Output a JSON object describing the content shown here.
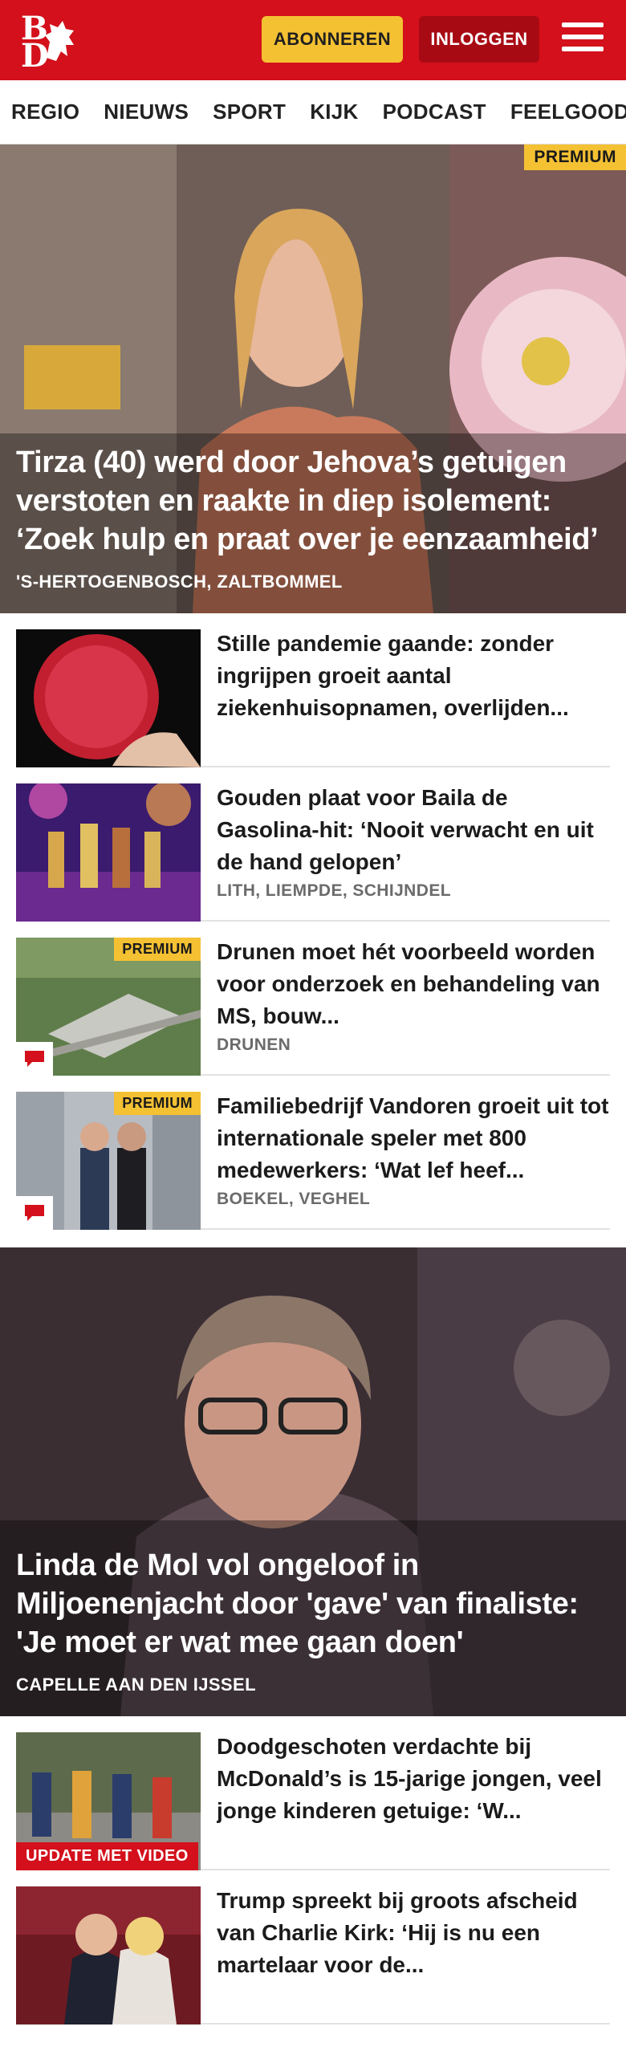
{
  "header": {
    "logo_text_top": "B",
    "logo_text_bottom": "D",
    "subscribe_label": "ABONNEREN",
    "login_label": "INLOGGEN",
    "brand_color": "#d3101b"
  },
  "nav": {
    "items": [
      "REGIO",
      "NIEUWS",
      "SPORT",
      "KIJK",
      "PODCAST",
      "FEELGOOD"
    ]
  },
  "hero1": {
    "badge": "PREMIUM",
    "title": "Tirza (40) werd door Jehova’s getuigen verstoten en raakte in diep isolement: ‘Zoek hulp en praat over je eenzaamheid’",
    "location": "'S-HERTOGENBOSCH, ZALTBOMMEL"
  },
  "articles1": [
    {
      "title": "Stille pandemie gaande: zonder ingrijpen groeit aantal ziekenhuisopnamen, overlijden...",
      "location": ""
    },
    {
      "title": "Gouden plaat voor Baila de Gasolina-hit: ‘Nooit verwacht en uit de hand gelopen’",
      "location": "LITH, LIEMPDE, SCHIJNDEL"
    },
    {
      "badge": "PREMIUM",
      "title": "Drunen moet hét voorbeeld worden voor onderzoek en behandeling van MS, bouw...",
      "location": "DRUNEN"
    },
    {
      "badge": "PREMIUM",
      "title": "Familiebedrijf Vandoren groeit uit tot internationale speler met 800 medewerkers: ‘Wat lef heef...",
      "location": "BOEKEL, VEGHEL"
    }
  ],
  "hero2": {
    "title": "Linda de Mol vol ongeloof in Miljoenenjacht door 'gave' van finaliste: 'Je moet er wat mee gaan doen'",
    "location": "CAPELLE AAN DEN IJSSEL"
  },
  "articles2": [
    {
      "badge": "UPDATE MET VIDEO",
      "title": "Doodgeschoten verdachte bij McDonald’s is 15-jarige jongen, veel jonge kinderen getuige: ‘W..."
    },
    {
      "title": "Trump spreekt bij groots afscheid van Charlie Kirk: ‘Hij is nu een martelaar voor de..."
    }
  ],
  "icons": {
    "menu": "hamburger-icon",
    "comment": "comment-icon"
  }
}
